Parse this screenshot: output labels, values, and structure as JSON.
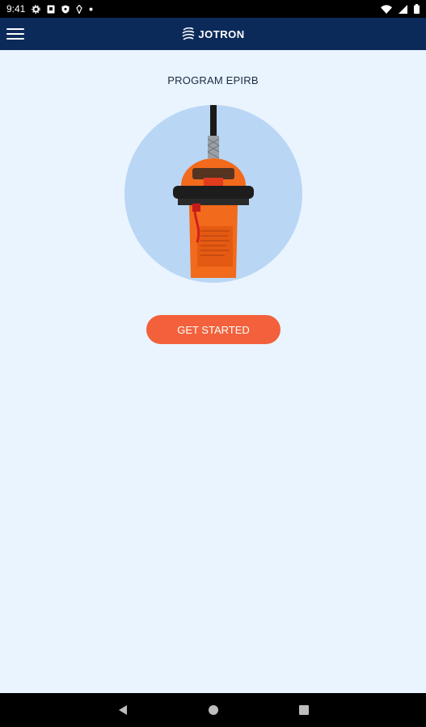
{
  "status_bar": {
    "time": "9:41",
    "left_icons": [
      "settings-icon",
      "shield-icon",
      "play-protect-icon",
      "location-icon",
      "dot-icon"
    ],
    "right_icons": [
      "wifi-icon",
      "signal-icon",
      "battery-icon"
    ]
  },
  "app_bar": {
    "brand": "JOTRON",
    "menu_icon": "hamburger-menu-icon"
  },
  "main": {
    "title": "PROGRAM EPIRB",
    "image": "epirb-beacon",
    "cta_label": "GET STARTED"
  },
  "nav_bar": {
    "buttons": [
      "back-icon",
      "home-icon",
      "recents-icon"
    ]
  },
  "colors": {
    "app_bar": "#0b2a5a",
    "background": "#eaf4fe",
    "circle": "#b9d6f5",
    "accent": "#f2613b"
  }
}
